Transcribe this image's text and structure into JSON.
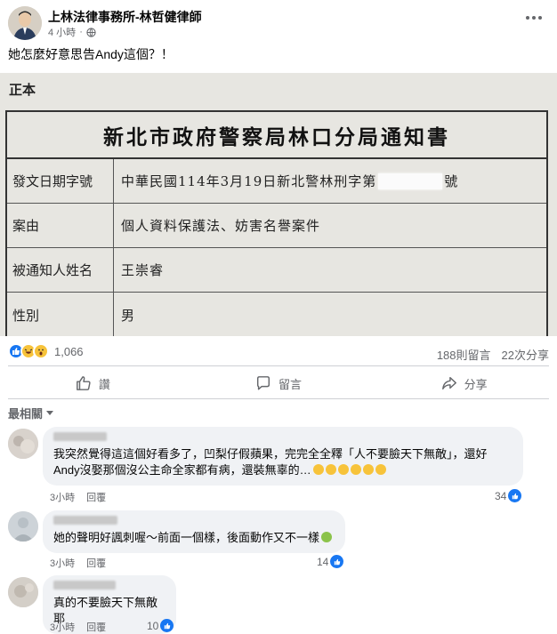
{
  "header": {
    "author": "上林法律事務所-林哲健律師",
    "time": "4 小時"
  },
  "post": {
    "text": "她怎麼好意思告Andy這個？！"
  },
  "document": {
    "label": "正本",
    "title": "新北市政府警察局林口分局通知書",
    "rows": [
      {
        "key": "發文日期字號",
        "value_pre": "中華民國114年3月19日新北警林刑字第",
        "value_post": "號"
      },
      {
        "key": "案由",
        "value": "個人資料保護法、妨害名譽案件"
      },
      {
        "key": "被通知人姓名",
        "value": "王崇睿"
      },
      {
        "key": "性別",
        "value": "男"
      }
    ]
  },
  "reactions": {
    "count": "1,066",
    "comments": "188則留言",
    "shares": "22次分享"
  },
  "actions": {
    "like": "讚",
    "comment": "留言",
    "share": "分享"
  },
  "sort": {
    "label": "最相關"
  },
  "comments": [
    {
      "text": "我突然覺得這這個好看多了，凹梨仔假蘋果，完完全全釋「人不要臉天下無敵」，還好Andy沒娶那個沒公主命全家都有病，還裝無辜的…",
      "time": "3小時",
      "reply": "回覆",
      "likes": "34"
    },
    {
      "text": "她的聲明好諷刺喔～前面一個樣，後面動作又不一樣",
      "time": "3小時",
      "reply": "回覆",
      "likes": "14"
    },
    {
      "text": "真的不要臉天下無敵耶",
      "time": "3小時",
      "reply": "回覆",
      "likes": "10"
    }
  ],
  "colors": {
    "accent": "#1877f2",
    "muted": "#65676b",
    "bubble": "#f0f2f5"
  }
}
